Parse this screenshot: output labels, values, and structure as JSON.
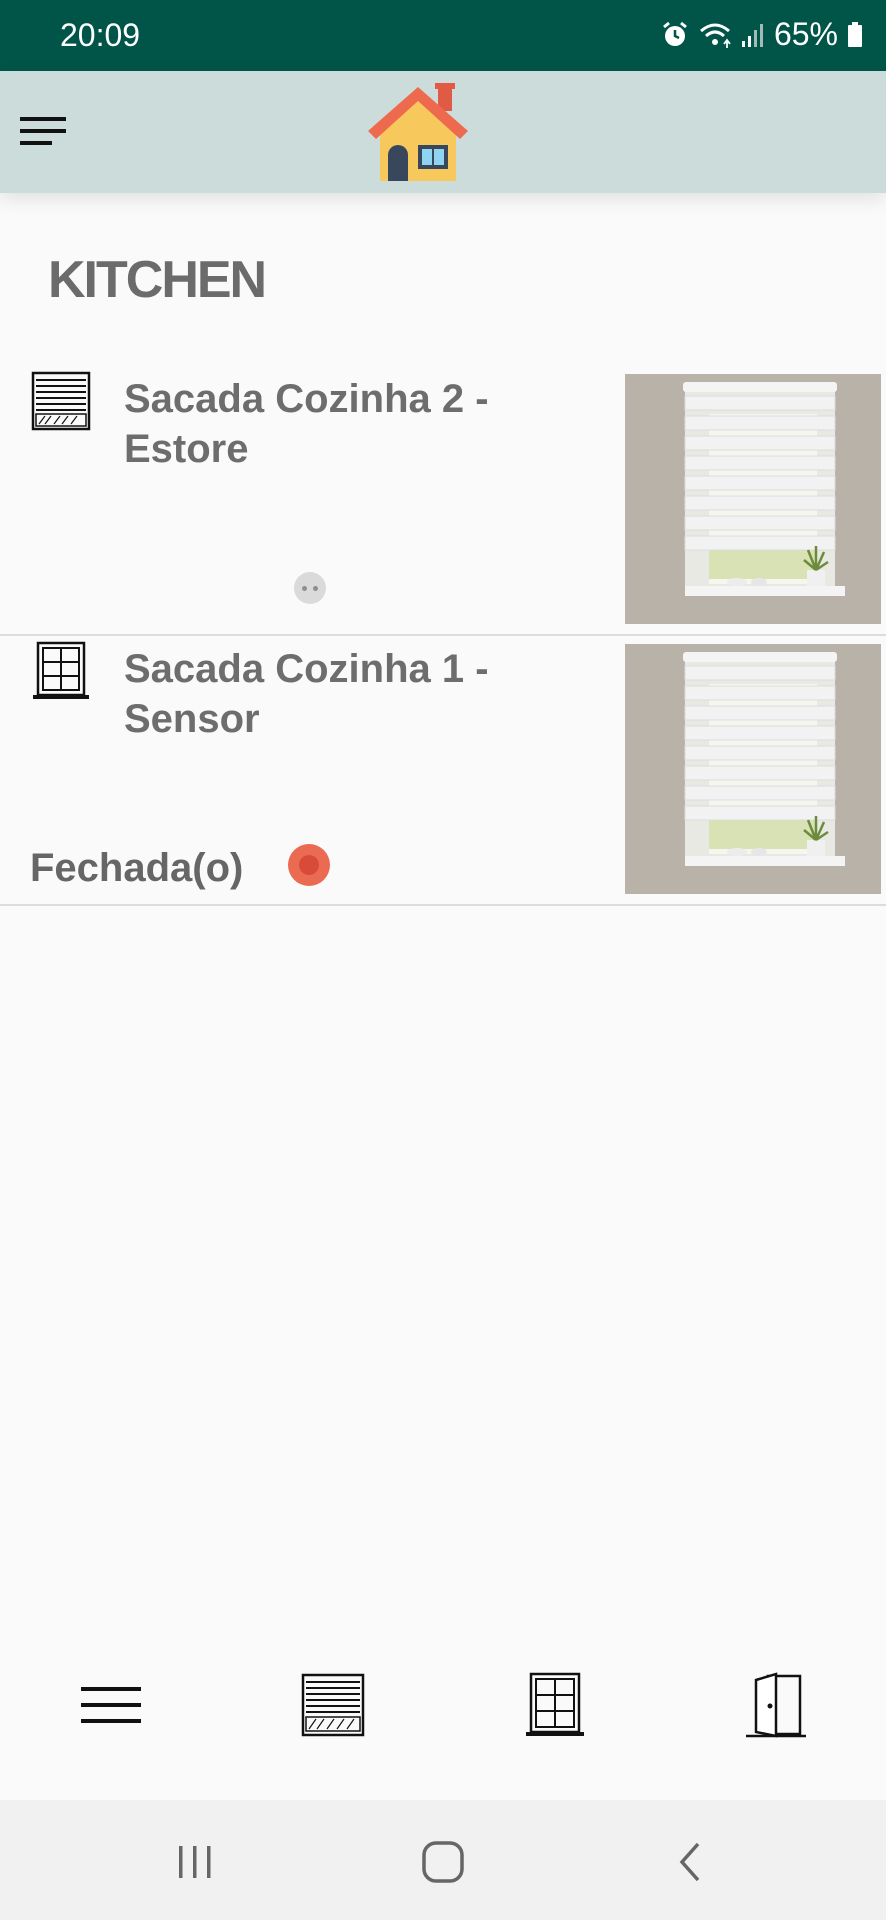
{
  "status_bar": {
    "time": "20:09",
    "battery": "65%"
  },
  "room": {
    "title": "KITCHEN"
  },
  "devices": [
    {
      "name": "Sacada Cozinha 2 - Estore",
      "type": "blind-icon"
    },
    {
      "name": "Sacada Cozinha 1 - Sensor",
      "type": "window-icon",
      "status": "Fechada(o)",
      "status_color": "#e05a45"
    }
  ],
  "colors": {
    "status_bar": "#005548",
    "app_bar": "#ccdcda",
    "background": "#fafafa"
  },
  "bottom_nav": [
    "menu-icon",
    "blind-icon",
    "window-icon",
    "door-icon"
  ]
}
